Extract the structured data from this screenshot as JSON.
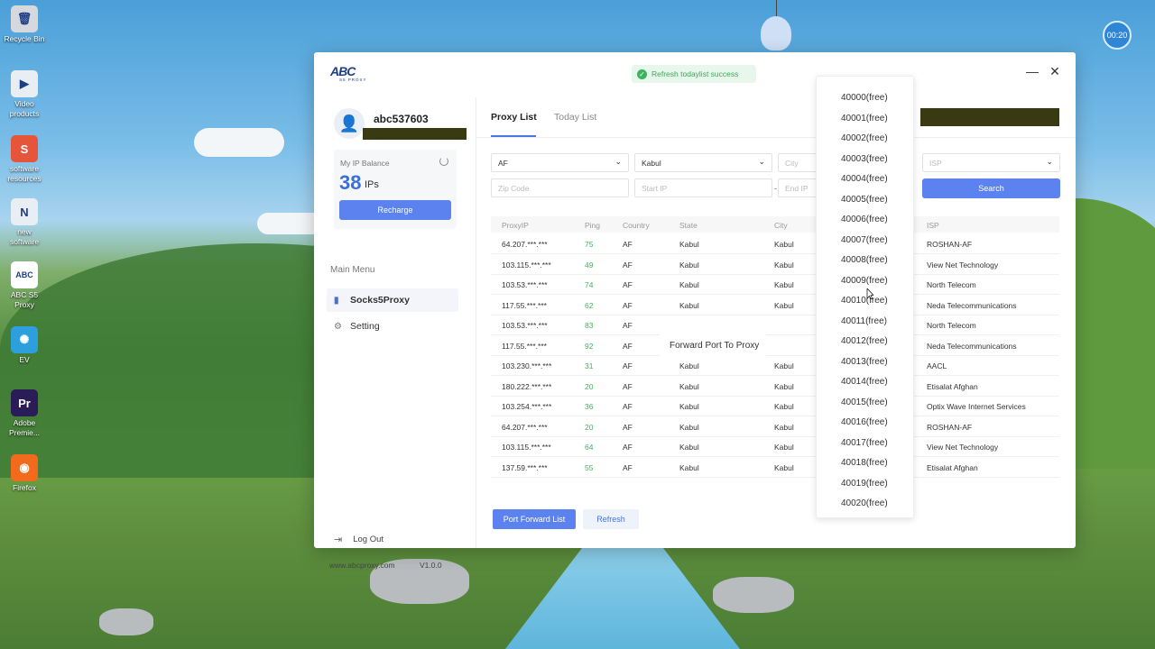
{
  "desktop": {
    "icons": [
      {
        "label": "Recycle Bin",
        "glyph": "🗑",
        "color": "#d5d8dc"
      },
      {
        "label": "Video products",
        "glyph": "▶",
        "color": "#e9edf4"
      },
      {
        "label": "software resources",
        "glyph": "S",
        "color": "#e6553a"
      },
      {
        "label": "new software",
        "glyph": "N",
        "color": "#e9edf4"
      },
      {
        "label": "ABC S5 Proxy",
        "glyph": "ABC",
        "color": "#ffffff"
      },
      {
        "label": "EV",
        "glyph": "✺",
        "color": "#2d9fdc"
      },
      {
        "label": "Adobe Premie...",
        "glyph": "Pr",
        "color": "#2a1c56"
      },
      {
        "label": "Firefox",
        "glyph": "◉",
        "color": "#f26a1b"
      }
    ],
    "timer": "00:20"
  },
  "window": {
    "logo_text": "ABC",
    "logo_sub": "S5 PROXY",
    "toast": "Refresh todaylist success",
    "minimize": "—",
    "close": "✕"
  },
  "sidebar": {
    "username": "abc537603",
    "balance_title": "My IP Balance",
    "balance_value": "38",
    "balance_unit": "IPs",
    "recharge": "Recharge",
    "main_menu": "Main Menu",
    "items": [
      {
        "label": "Socks5Proxy",
        "icon": "phone-icon"
      },
      {
        "label": "Setting",
        "icon": "gear-icon"
      }
    ],
    "logout": "Log Out",
    "site": "www.abcproxy.com",
    "version": "V1.0.0"
  },
  "tabs": [
    "Proxy List",
    "Today List"
  ],
  "filters": {
    "country": "AF",
    "state": "Kabul",
    "city_placeholder": "City",
    "isp_placeholder": "ISP",
    "zip_placeholder": "Zip Code",
    "start_ip_placeholder": "Start IP",
    "end_ip_placeholder": "End IP",
    "dash": "-",
    "search": "Search"
  },
  "table": {
    "headers": [
      "ProxyIP",
      "Ping",
      "Country",
      "State",
      "City",
      "ISP"
    ],
    "rows": [
      [
        "64.207.***.***",
        "75",
        "AF",
        "Kabul",
        "Kabul",
        "ROSHAN-AF"
      ],
      [
        "103.115.***.***",
        "49",
        "AF",
        "Kabul",
        "Kabul",
        "View Net Technology"
      ],
      [
        "103.53.***.***",
        "74",
        "AF",
        "Kabul",
        "Kabul",
        "North Telecom"
      ],
      [
        "117.55.***.***",
        "62",
        "AF",
        "Kabul",
        "Kabul",
        "Neda Telecommunications"
      ],
      [
        "103.53.***.***",
        "83",
        "AF",
        "",
        "",
        "North Telecom"
      ],
      [
        "117.55.***.***",
        "92",
        "AF",
        "",
        "",
        "Neda Telecommunications"
      ],
      [
        "103.230.***.***",
        "31",
        "AF",
        "Kabul",
        "Kabul",
        "AACL"
      ],
      [
        "180.222.***.***",
        "20",
        "AF",
        "Kabul",
        "Kabul",
        "Etisalat Afghan"
      ],
      [
        "103.254.***.***",
        "36",
        "AF",
        "Kabul",
        "Kabul",
        "Optix Wave Internet Services"
      ],
      [
        "64.207.***.***",
        "20",
        "AF",
        "Kabul",
        "Kabul",
        "ROSHAN-AF"
      ],
      [
        "103.115.***.***",
        "64",
        "AF",
        "Kabul",
        "Kabul",
        "View Net Technology"
      ],
      [
        "137.59.***.***",
        "55",
        "AF",
        "Kabul",
        "Kabul",
        "Etisalat Afghan"
      ]
    ]
  },
  "context_menu": "Forward Port To Proxy",
  "footer": {
    "port_forward_list": "Port Forward List",
    "refresh": "Refresh"
  },
  "port_dropdown": [
    "40000(free)",
    "40001(free)",
    "40002(free)",
    "40003(free)",
    "40004(free)",
    "40005(free)",
    "40006(free)",
    "40007(free)",
    "40008(free)",
    "40009(free)",
    "40010(free)",
    "40011(free)",
    "40012(free)",
    "40013(free)",
    "40014(free)",
    "40015(free)",
    "40016(free)",
    "40017(free)",
    "40018(free)",
    "40019(free)",
    "40020(free)"
  ]
}
